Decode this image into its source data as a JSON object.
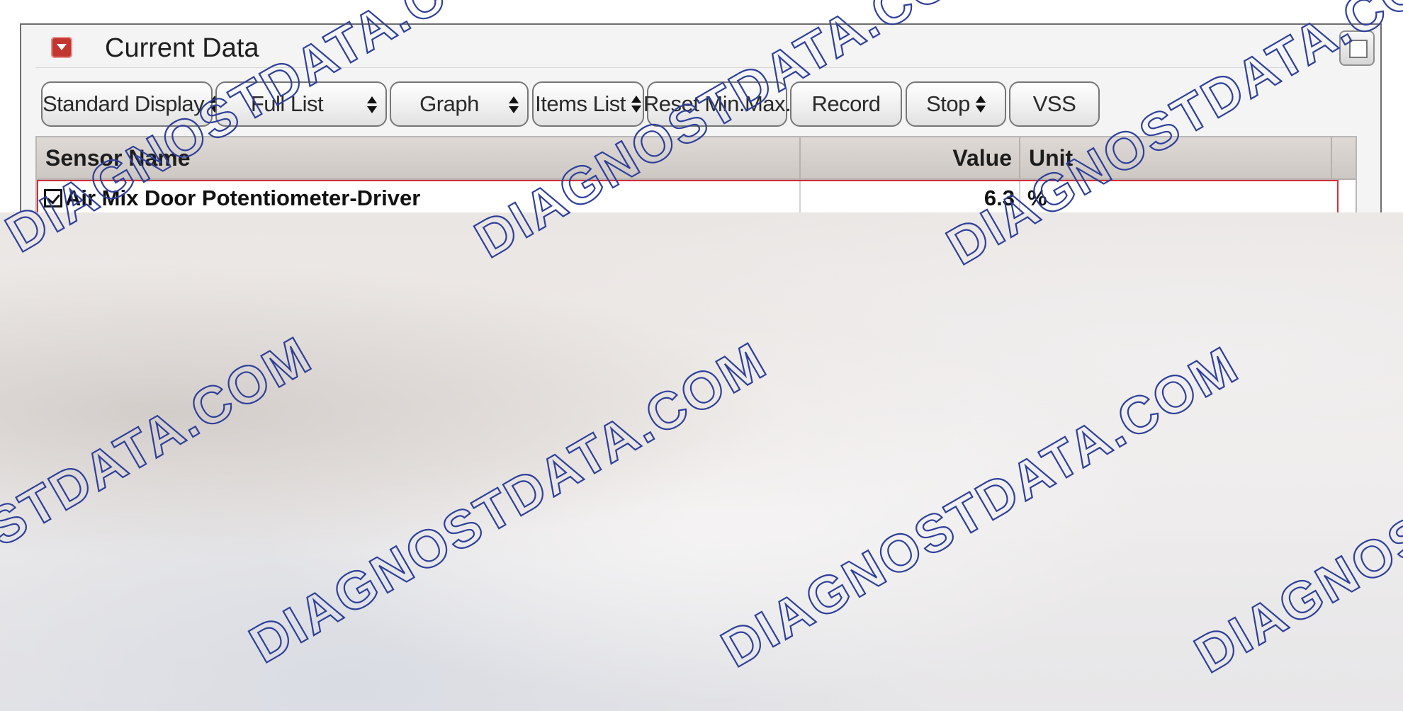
{
  "panel": {
    "title": "Current Data"
  },
  "toolbar": {
    "standard_display": "Standard Display",
    "full_list": "Full List",
    "graph": "Graph",
    "items_list": "Items List",
    "reset_min_max": "Reset Min.Max.",
    "record": "Record",
    "stop": "Stop",
    "vss": "VSS"
  },
  "table": {
    "columns": [
      "Sensor Name",
      "Value",
      "Unit"
    ],
    "rows": [
      {
        "name": "Air Mix Door Potentiometer-Driver",
        "value": "6.3",
        "unit": "%",
        "checked": true
      }
    ]
  },
  "watermark": "DIAGNOSTDATA.COM",
  "colors": {
    "collapse_button": "#c3362f",
    "selected_row_border": "#d0303d",
    "watermark_outline": "#2e3f9a"
  }
}
